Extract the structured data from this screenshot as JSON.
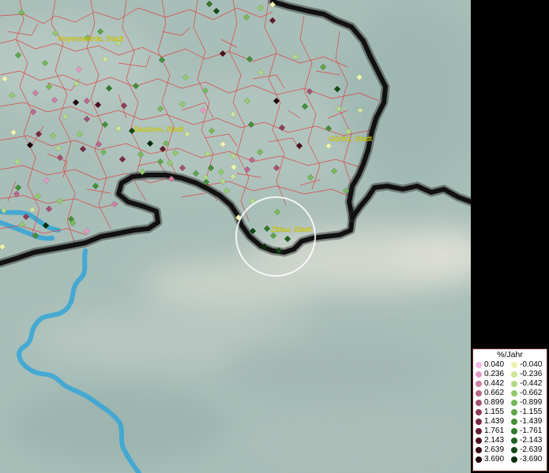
{
  "map": {
    "cities": [
      {
        "name": "Hoyerswerda, Stadt"
      },
      {
        "name": "Bautzen, Stadt"
      },
      {
        "name": "Görlitz, Stadt"
      },
      {
        "name": "Zittau, Stadt"
      }
    ],
    "colors": {
      "terrain": "#a9c0ba",
      "municipality_boundary": "#e03a3a",
      "national_border": "#111111",
      "river": "#3aa6d6",
      "label": "#e8e000",
      "highlight_circle": "#ffffff"
    }
  },
  "legend": {
    "title": "%/Jahr",
    "rows": [
      {
        "pos": "0.040",
        "neg": "-0.040",
        "pos_color": "#f5b8e8",
        "neg_color": "#eef3b0"
      },
      {
        "pos": "0.236",
        "neg": "-0.236",
        "pos_color": "#e19ac5",
        "neg_color": "#cfe39c"
      },
      {
        "pos": "0.442",
        "neg": "-0.442",
        "pos_color": "#cc7fa6",
        "neg_color": "#b3d98a"
      },
      {
        "pos": "0.662",
        "neg": "-0.662",
        "pos_color": "#b9678a",
        "neg_color": "#94c96f"
      },
      {
        "pos": "0.899",
        "neg": "-0.899",
        "pos_color": "#a55071",
        "neg_color": "#78b85a"
      },
      {
        "pos": "1.155",
        "neg": "-1.155",
        "pos_color": "#8f3c59",
        "neg_color": "#5ea548"
      },
      {
        "pos": "1.439",
        "neg": "-1.439",
        "pos_color": "#7a2a44",
        "neg_color": "#458f38"
      },
      {
        "pos": "1.761",
        "neg": "-1.761",
        "pos_color": "#641c30",
        "neg_color": "#2f7a2a"
      },
      {
        "pos": "2.143",
        "neg": "-2.143",
        "pos_color": "#4d1020",
        "neg_color": "#1f6220"
      },
      {
        "pos": "2.639",
        "neg": "-2.639",
        "pos_color": "#350813",
        "neg_color": "#114a15"
      },
      {
        "pos": "3.690",
        "neg": "-3.690",
        "pos_color": "#1e030a",
        "neg_color": "#06300b"
      }
    ]
  }
}
